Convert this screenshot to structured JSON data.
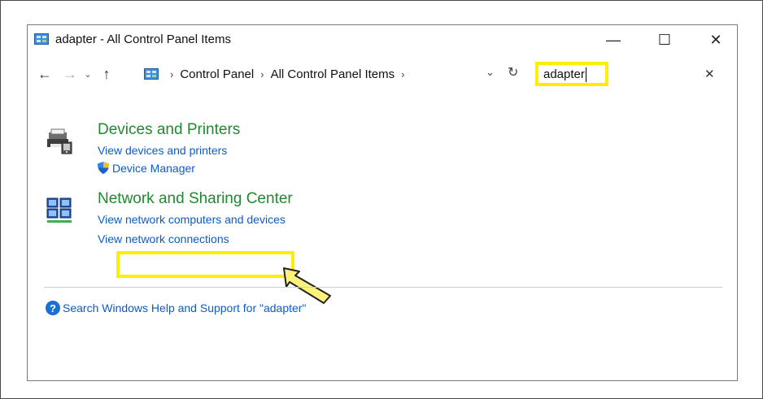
{
  "window": {
    "title": "adapter - All Control Panel Items",
    "minimize_glyph": "—",
    "maximize_glyph": "☐",
    "close_glyph": "✕"
  },
  "nav": {
    "back_glyph": "←",
    "forward_glyph": "→",
    "recent_glyph": "⌄",
    "up_glyph": "↑",
    "breadcrumbs": [
      "Control Panel",
      "All Control Panel Items"
    ],
    "breadcrumb_sep": "›",
    "dropdown_glyph": "⌄",
    "refresh_glyph": "↻"
  },
  "search": {
    "value": "adapter",
    "clear_glyph": "✕"
  },
  "results": {
    "devices": {
      "title": "Devices and Printers",
      "links": [
        "View devices and printers",
        "Device Manager"
      ]
    },
    "network": {
      "title": "Network and Sharing Center",
      "links": [
        "View network computers and devices",
        "View network connections"
      ]
    }
  },
  "help": {
    "icon_glyph": "?",
    "text": "Search Windows Help and Support for \"adapter\""
  },
  "colors": {
    "highlight": "#ffee00",
    "category_title": "#1e8a2e",
    "link": "#0b5cc8"
  }
}
